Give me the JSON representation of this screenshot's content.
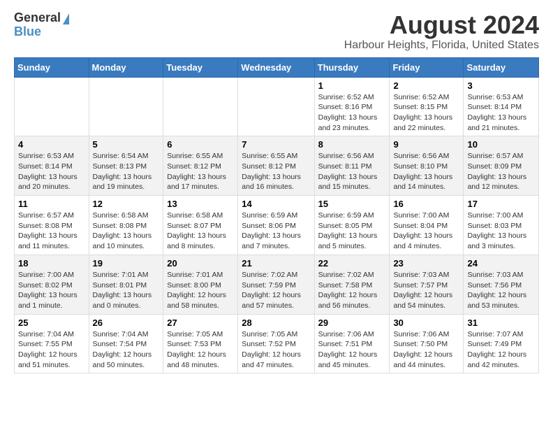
{
  "logo": {
    "general": "General",
    "blue": "Blue"
  },
  "header": {
    "month_year": "August 2024",
    "location": "Harbour Heights, Florida, United States"
  },
  "weekdays": [
    "Sunday",
    "Monday",
    "Tuesday",
    "Wednesday",
    "Thursday",
    "Friday",
    "Saturday"
  ],
  "weeks": [
    [
      {
        "day": "",
        "info": ""
      },
      {
        "day": "",
        "info": ""
      },
      {
        "day": "",
        "info": ""
      },
      {
        "day": "",
        "info": ""
      },
      {
        "day": "1",
        "info": "Sunrise: 6:52 AM\nSunset: 8:16 PM\nDaylight: 13 hours\nand 23 minutes."
      },
      {
        "day": "2",
        "info": "Sunrise: 6:52 AM\nSunset: 8:15 PM\nDaylight: 13 hours\nand 22 minutes."
      },
      {
        "day": "3",
        "info": "Sunrise: 6:53 AM\nSunset: 8:14 PM\nDaylight: 13 hours\nand 21 minutes."
      }
    ],
    [
      {
        "day": "4",
        "info": "Sunrise: 6:53 AM\nSunset: 8:14 PM\nDaylight: 13 hours\nand 20 minutes."
      },
      {
        "day": "5",
        "info": "Sunrise: 6:54 AM\nSunset: 8:13 PM\nDaylight: 13 hours\nand 19 minutes."
      },
      {
        "day": "6",
        "info": "Sunrise: 6:55 AM\nSunset: 8:12 PM\nDaylight: 13 hours\nand 17 minutes."
      },
      {
        "day": "7",
        "info": "Sunrise: 6:55 AM\nSunset: 8:12 PM\nDaylight: 13 hours\nand 16 minutes."
      },
      {
        "day": "8",
        "info": "Sunrise: 6:56 AM\nSunset: 8:11 PM\nDaylight: 13 hours\nand 15 minutes."
      },
      {
        "day": "9",
        "info": "Sunrise: 6:56 AM\nSunset: 8:10 PM\nDaylight: 13 hours\nand 14 minutes."
      },
      {
        "day": "10",
        "info": "Sunrise: 6:57 AM\nSunset: 8:09 PM\nDaylight: 13 hours\nand 12 minutes."
      }
    ],
    [
      {
        "day": "11",
        "info": "Sunrise: 6:57 AM\nSunset: 8:08 PM\nDaylight: 13 hours\nand 11 minutes."
      },
      {
        "day": "12",
        "info": "Sunrise: 6:58 AM\nSunset: 8:08 PM\nDaylight: 13 hours\nand 10 minutes."
      },
      {
        "day": "13",
        "info": "Sunrise: 6:58 AM\nSunset: 8:07 PM\nDaylight: 13 hours\nand 8 minutes."
      },
      {
        "day": "14",
        "info": "Sunrise: 6:59 AM\nSunset: 8:06 PM\nDaylight: 13 hours\nand 7 minutes."
      },
      {
        "day": "15",
        "info": "Sunrise: 6:59 AM\nSunset: 8:05 PM\nDaylight: 13 hours\nand 5 minutes."
      },
      {
        "day": "16",
        "info": "Sunrise: 7:00 AM\nSunset: 8:04 PM\nDaylight: 13 hours\nand 4 minutes."
      },
      {
        "day": "17",
        "info": "Sunrise: 7:00 AM\nSunset: 8:03 PM\nDaylight: 13 hours\nand 3 minutes."
      }
    ],
    [
      {
        "day": "18",
        "info": "Sunrise: 7:00 AM\nSunset: 8:02 PM\nDaylight: 13 hours\nand 1 minute."
      },
      {
        "day": "19",
        "info": "Sunrise: 7:01 AM\nSunset: 8:01 PM\nDaylight: 13 hours\nand 0 minutes."
      },
      {
        "day": "20",
        "info": "Sunrise: 7:01 AM\nSunset: 8:00 PM\nDaylight: 12 hours\nand 58 minutes."
      },
      {
        "day": "21",
        "info": "Sunrise: 7:02 AM\nSunset: 7:59 PM\nDaylight: 12 hours\nand 57 minutes."
      },
      {
        "day": "22",
        "info": "Sunrise: 7:02 AM\nSunset: 7:58 PM\nDaylight: 12 hours\nand 56 minutes."
      },
      {
        "day": "23",
        "info": "Sunrise: 7:03 AM\nSunset: 7:57 PM\nDaylight: 12 hours\nand 54 minutes."
      },
      {
        "day": "24",
        "info": "Sunrise: 7:03 AM\nSunset: 7:56 PM\nDaylight: 12 hours\nand 53 minutes."
      }
    ],
    [
      {
        "day": "25",
        "info": "Sunrise: 7:04 AM\nSunset: 7:55 PM\nDaylight: 12 hours\nand 51 minutes."
      },
      {
        "day": "26",
        "info": "Sunrise: 7:04 AM\nSunset: 7:54 PM\nDaylight: 12 hours\nand 50 minutes."
      },
      {
        "day": "27",
        "info": "Sunrise: 7:05 AM\nSunset: 7:53 PM\nDaylight: 12 hours\nand 48 minutes."
      },
      {
        "day": "28",
        "info": "Sunrise: 7:05 AM\nSunset: 7:52 PM\nDaylight: 12 hours\nand 47 minutes."
      },
      {
        "day": "29",
        "info": "Sunrise: 7:06 AM\nSunset: 7:51 PM\nDaylight: 12 hours\nand 45 minutes."
      },
      {
        "day": "30",
        "info": "Sunrise: 7:06 AM\nSunset: 7:50 PM\nDaylight: 12 hours\nand 44 minutes."
      },
      {
        "day": "31",
        "info": "Sunrise: 7:07 AM\nSunset: 7:49 PM\nDaylight: 12 hours\nand 42 minutes."
      }
    ]
  ]
}
